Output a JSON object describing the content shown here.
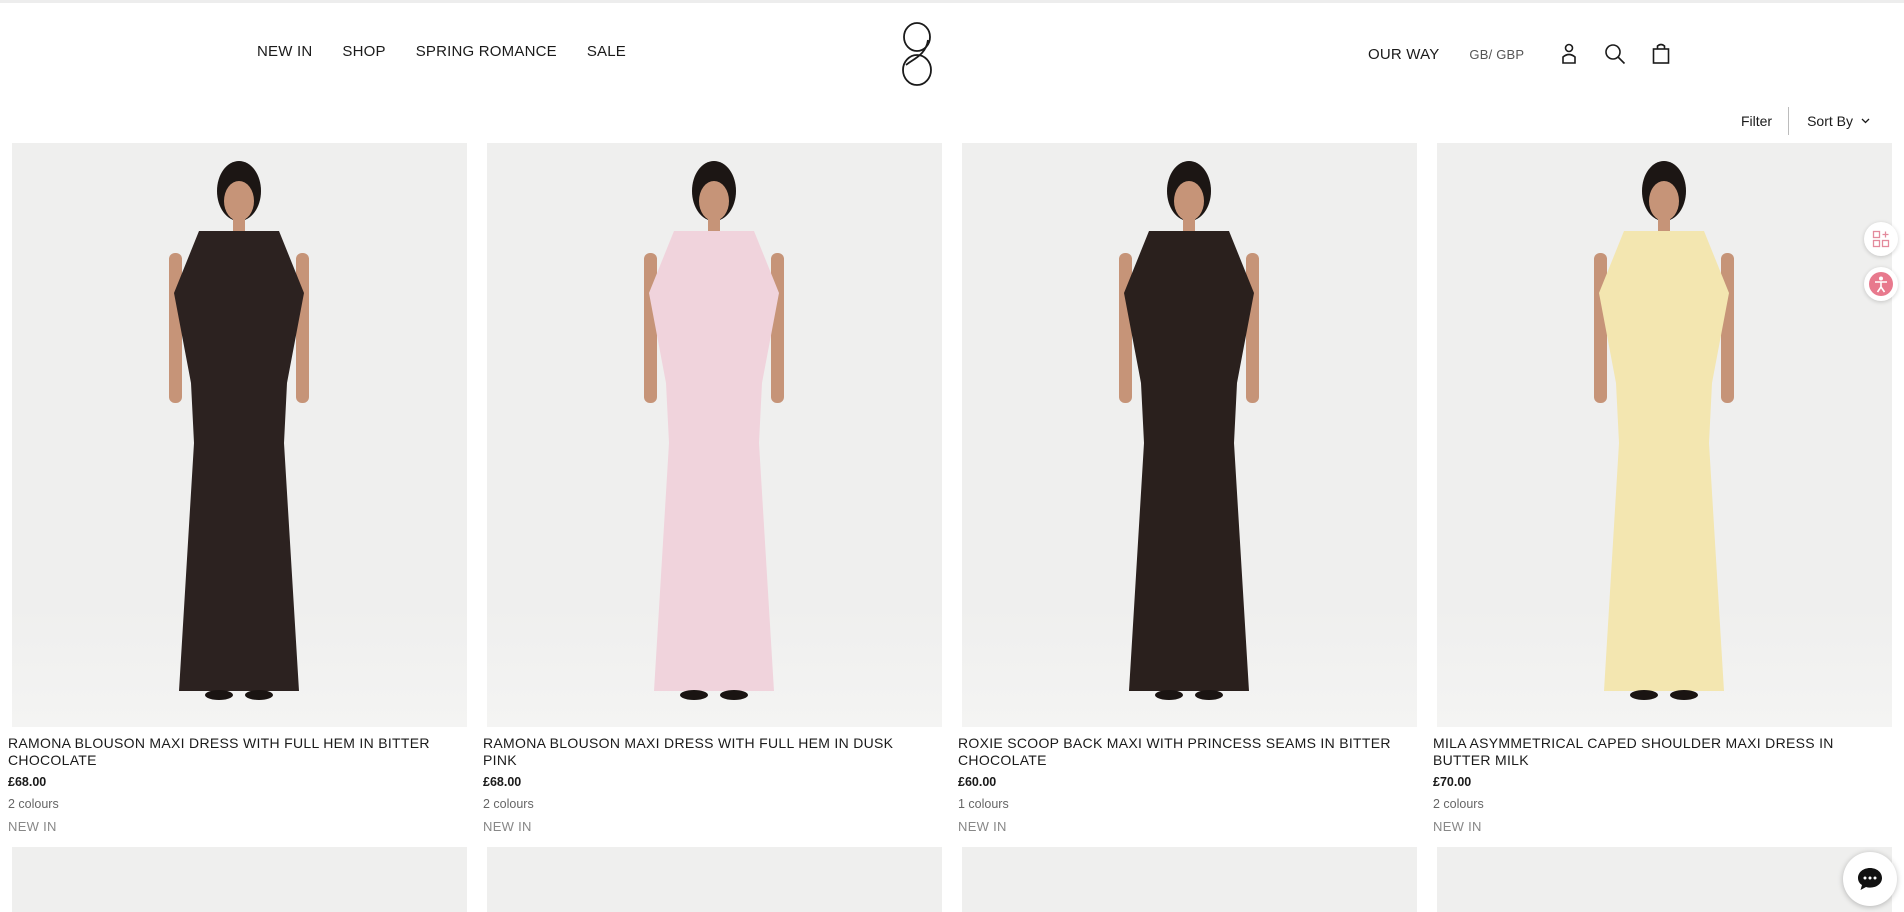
{
  "header": {
    "nav_left": [
      {
        "label": "NEW IN"
      },
      {
        "label": "SHOP"
      },
      {
        "label": "SPRING ROMANCE"
      },
      {
        "label": "SALE"
      }
    ],
    "logo_icon": "brand-logo",
    "our_way": "OUR WAY",
    "currency": "GB/ GBP",
    "icons": [
      "account-icon",
      "search-icon",
      "bag-icon"
    ]
  },
  "toolbar": {
    "filter": "Filter",
    "sort": "Sort By"
  },
  "products": [
    {
      "name": "RAMONA BLOUSON MAXI DRESS WITH FULL HEM IN BITTER CHOCOLATE",
      "price": "£68.00",
      "colours": "2 colours",
      "tag": "NEW IN",
      "dress_color": "#2c2220",
      "hair_color": "#1c1614"
    },
    {
      "name": "RAMONA BLOUSON MAXI DRESS WITH FULL HEM IN DUSK PINK",
      "price": "£68.00",
      "colours": "2 colours",
      "tag": "NEW IN",
      "dress_color": "#f0d3dc",
      "hair_color": "#1c1614"
    },
    {
      "name": "ROXIE SCOOP BACK MAXI WITH PRINCESS SEAMS IN BITTER CHOCOLATE",
      "price": "£60.00",
      "colours": "1 colours",
      "tag": "NEW IN",
      "dress_color": "#2a201d",
      "hair_color": "#1c1614"
    },
    {
      "name": "MILA ASYMMETRICAL CAPED SHOULDER MAXI DRESS IN BUTTER MILK",
      "price": "£70.00",
      "colours": "2 colours",
      "tag": "NEW IN",
      "dress_color": "#f3e6b0",
      "hair_color": "#1c1614"
    }
  ],
  "widgets": {
    "apps_icon": "apps-icon",
    "accessibility_icon": "accessibility-icon",
    "chat_icon": "chat-icon"
  },
  "colors": {
    "skin": "#c69478",
    "background": "#efefee"
  }
}
